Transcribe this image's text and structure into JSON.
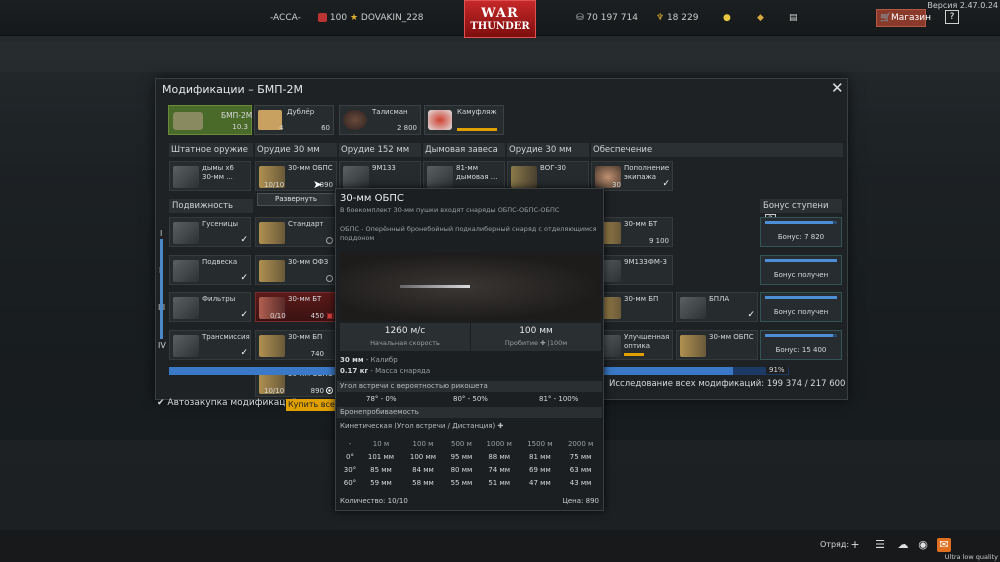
{
  "top": {
    "squad_tag": "-ACCA-",
    "level": "100",
    "nickname": "DOVAKIN_228",
    "logo_line1": "WAR",
    "logo_line2": "THUNDER",
    "silver": "70 197 714",
    "gold": "18 229",
    "shop": "Магазин",
    "help": "?",
    "version": "Версия 2.47.0.24"
  },
  "modal": {
    "title": "Модификации – БМП-2М",
    "vehicle": {
      "name": "БМП-2М",
      "br": "10.3"
    },
    "crew": {
      "name": "Дублёр",
      "count": "4",
      "price": "60"
    },
    "talisman": {
      "name": "Талисман",
      "price": "2 800"
    },
    "camo": {
      "name": "Камуфляж"
    },
    "categories": [
      "Штатное оружие",
      "Орудие 30 мм",
      "Орудие 152 мм",
      "Дымовая завеса",
      "Орудие 30 мм",
      "Обеспечение"
    ],
    "row1": [
      {
        "name": "дымы х6\n30-мм ..."
      },
      {
        "name": "30-мм ОБПС",
        "count": "10/10",
        "price": "890"
      },
      {
        "name": "9М133"
      },
      {
        "name": "81-мм\nдымовая ..."
      },
      {
        "name": "ВОГ-30"
      },
      {
        "name": "Пополнение\nэкипажа",
        "count": "30"
      }
    ],
    "expand": "Развернуть",
    "sections": {
      "mobility": "Подвижность",
      "bonus": "Бонус ступени",
      "bonus_help": "?"
    },
    "ranks": [
      "I",
      "II",
      "III",
      "IV"
    ],
    "mobility": [
      {
        "name": "Гусеницы"
      },
      {
        "name": "Подвеска"
      },
      {
        "name": "Фильтры"
      },
      {
        "name": "Трансмиссия"
      }
    ],
    "ammo": [
      {
        "name": "Стандарт"
      },
      {
        "name": "30-мм ОФЗ"
      },
      {
        "name": "30-мм БТ",
        "count": "0/10",
        "price": "450"
      },
      {
        "name": "30-мм БП",
        "price": "740"
      },
      {
        "name": "30-мм ОБПС",
        "count": "10/10",
        "price": "890"
      }
    ],
    "right": [
      {
        "name": "30-мм БТ",
        "price": "9 100"
      },
      {
        "name": "9М133ФМ-3"
      },
      {
        "name": "30-мм БП"
      },
      {
        "name": "БПЛА"
      },
      {
        "name": "Улучшенная\nоптика"
      },
      {
        "name": "30-мм ОБПС"
      }
    ],
    "bonuses": [
      {
        "text": "Бонус: 7 820",
        "progress": 0.95
      },
      {
        "text": "Бонус получен",
        "progress": 1
      },
      {
        "text": "Бонус получен",
        "progress": 1
      },
      {
        "text": "Бонус: 15 400",
        "progress": 0.95
      }
    ],
    "progress_pct": "91%",
    "progress_value": 0.91,
    "research_all": "Исследование всех модификаций: 199 374",
    "research_total": "/ 217 600",
    "autobuy": "Автозакупка модификаций",
    "buy_all": "Купить все"
  },
  "tooltip": {
    "title": "30-мм ОБПС",
    "desc1": "В боекомплект 30-мм пушки входят снаряды ОБПС-ОБПС-ОБПС",
    "desc2": "ОБПС - Оперённый бронебойный подкалиберный снаряд с отделяющимся поддоном",
    "speed": "1260 м/с",
    "speed_label": "Начальная скорость",
    "pen": "100 мм",
    "pen_label": "Пробитие",
    "pen_unit": "|100м",
    "caliber_val": "30 мм",
    "caliber": "- Калибр",
    "mass_val": "0.17 кг",
    "mass": "- Масса снаряда",
    "ricochet_title": "Угол встречи с вероятностью рикошета",
    "ricochet": [
      "78° - 0%",
      "80° - 50%",
      "81° - 100%"
    ],
    "armor_title": "Бронепробиваемость",
    "kinetic": "Кинетическая (Угол встречи / Дистанция)",
    "table": [
      [
        "-",
        "10 м",
        "100 м",
        "500 м",
        "1000 м",
        "1500 м",
        "2000 м"
      ],
      [
        "0°",
        "101 мм",
        "100 мм",
        "95 мм",
        "88 мм",
        "81 мм",
        "75 мм"
      ],
      [
        "30°",
        "85 мм",
        "84 мм",
        "80 мм",
        "74 мм",
        "69 мм",
        "63 мм"
      ],
      [
        "60°",
        "59 мм",
        "58 мм",
        "55 мм",
        "51 мм",
        "47 мм",
        "43 мм"
      ]
    ],
    "quantity": "Количество: 10/10",
    "price": "Цена: 890"
  },
  "bottom": {
    "squad": "Отряд:",
    "quality": "Ultra low quality"
  },
  "colors": {
    "accent": "#3a79c7",
    "shop": "#8a3a2a",
    "logo": "#c62828",
    "gold": "#e0a000"
  }
}
